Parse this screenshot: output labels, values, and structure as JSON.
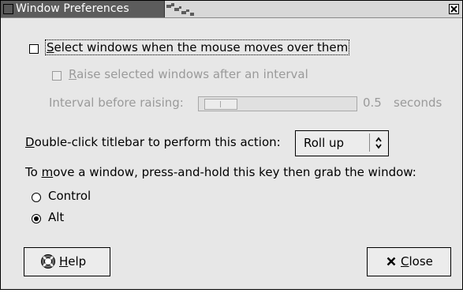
{
  "window": {
    "title": "Window Preferences"
  },
  "focus_windows": {
    "label_accel": "S",
    "label_rest": "elect windows when the mouse moves over them",
    "checked": false
  },
  "raise": {
    "label_accel": "R",
    "label_rest": "aise selected windows after an interval",
    "checked": false,
    "enabled": false
  },
  "interval": {
    "label": "Interval before raising:",
    "value": "0.5",
    "unit": "seconds",
    "slider_fraction": 0.05
  },
  "double_click": {
    "label_accel": "D",
    "label_rest": "ouble-click titlebar to perform this action:",
    "selected": "Roll up"
  },
  "move_key": {
    "label_pre": "To ",
    "label_accel": "m",
    "label_rest": "ove a window, press-and-hold this key then grab the window:",
    "options": [
      {
        "label": "Control",
        "checked": false
      },
      {
        "label": "Alt",
        "checked": true
      }
    ]
  },
  "buttons": {
    "help_accel": "H",
    "help_rest": "elp",
    "close_accel": "C",
    "close_rest": "lose"
  },
  "icons": {
    "help": "help-lifebuoy-icon",
    "close": "close-x-icon",
    "combo": "updown-arrows-icon"
  }
}
